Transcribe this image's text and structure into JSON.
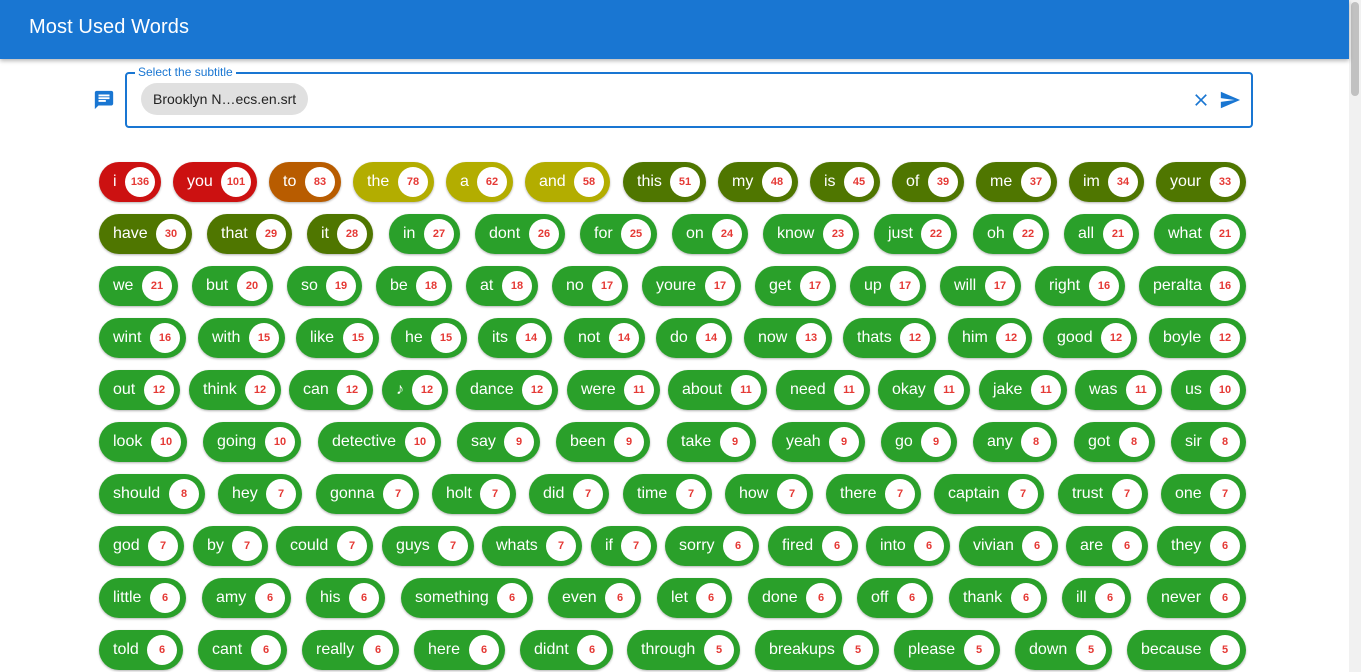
{
  "app": {
    "title": "Most Used Words"
  },
  "search": {
    "label": "Select the subtitle",
    "chip": "Brooklyn N…ecs.en.srt",
    "icons": {
      "field": "subtitles-icon",
      "clear": "close-icon",
      "send": "send-icon"
    }
  },
  "colors": {
    "appbar": "#1976d2",
    "badge_text": "#e53935",
    "levels": [
      "#cc1111",
      "#b85c00",
      "#b3ad00",
      "#4f7600",
      "#2aa02a"
    ]
  },
  "words": [
    {
      "w": "i",
      "n": 136
    },
    {
      "w": "you",
      "n": 101
    },
    {
      "w": "to",
      "n": 83
    },
    {
      "w": "the",
      "n": 78
    },
    {
      "w": "a",
      "n": 62
    },
    {
      "w": "and",
      "n": 58
    },
    {
      "w": "this",
      "n": 51
    },
    {
      "w": "my",
      "n": 48
    },
    {
      "w": "is",
      "n": 45
    },
    {
      "w": "of",
      "n": 39
    },
    {
      "w": "me",
      "n": 37
    },
    {
      "w": "im",
      "n": 34
    },
    {
      "w": "your",
      "n": 33
    },
    {
      "w": "have",
      "n": 30
    },
    {
      "w": "that",
      "n": 29
    },
    {
      "w": "it",
      "n": 28
    },
    {
      "w": "in",
      "n": 27
    },
    {
      "w": "dont",
      "n": 26
    },
    {
      "w": "for",
      "n": 25
    },
    {
      "w": "on",
      "n": 24
    },
    {
      "w": "know",
      "n": 23
    },
    {
      "w": "just",
      "n": 22
    },
    {
      "w": "oh",
      "n": 22
    },
    {
      "w": "all",
      "n": 21
    },
    {
      "w": "what",
      "n": 21
    },
    {
      "w": "we",
      "n": 21
    },
    {
      "w": "but",
      "n": 20
    },
    {
      "w": "so",
      "n": 19
    },
    {
      "w": "be",
      "n": 18
    },
    {
      "w": "at",
      "n": 18
    },
    {
      "w": "no",
      "n": 17
    },
    {
      "w": "youre",
      "n": 17
    },
    {
      "w": "get",
      "n": 17
    },
    {
      "w": "up",
      "n": 17
    },
    {
      "w": "will",
      "n": 17
    },
    {
      "w": "right",
      "n": 16
    },
    {
      "w": "peralta",
      "n": 16
    },
    {
      "w": "wint",
      "n": 16
    },
    {
      "w": "with",
      "n": 15
    },
    {
      "w": "like",
      "n": 15
    },
    {
      "w": "he",
      "n": 15
    },
    {
      "w": "its",
      "n": 14
    },
    {
      "w": "not",
      "n": 14
    },
    {
      "w": "do",
      "n": 14
    },
    {
      "w": "now",
      "n": 13
    },
    {
      "w": "thats",
      "n": 12
    },
    {
      "w": "him",
      "n": 12
    },
    {
      "w": "good",
      "n": 12
    },
    {
      "w": "boyle",
      "n": 12
    },
    {
      "w": "out",
      "n": 12
    },
    {
      "w": "think",
      "n": 12
    },
    {
      "w": "can",
      "n": 12
    },
    {
      "w": "♪",
      "n": 12
    },
    {
      "w": "dance",
      "n": 12
    },
    {
      "w": "were",
      "n": 11
    },
    {
      "w": "about",
      "n": 11
    },
    {
      "w": "need",
      "n": 11
    },
    {
      "w": "okay",
      "n": 11
    },
    {
      "w": "jake",
      "n": 11
    },
    {
      "w": "was",
      "n": 11
    },
    {
      "w": "us",
      "n": 10
    },
    {
      "w": "look",
      "n": 10
    },
    {
      "w": "going",
      "n": 10
    },
    {
      "w": "detective",
      "n": 10
    },
    {
      "w": "say",
      "n": 9
    },
    {
      "w": "been",
      "n": 9
    },
    {
      "w": "take",
      "n": 9
    },
    {
      "w": "yeah",
      "n": 9
    },
    {
      "w": "go",
      "n": 9
    },
    {
      "w": "any",
      "n": 8
    },
    {
      "w": "got",
      "n": 8
    },
    {
      "w": "sir",
      "n": 8
    },
    {
      "w": "should",
      "n": 8
    },
    {
      "w": "hey",
      "n": 7
    },
    {
      "w": "gonna",
      "n": 7
    },
    {
      "w": "holt",
      "n": 7
    },
    {
      "w": "did",
      "n": 7
    },
    {
      "w": "time",
      "n": 7
    },
    {
      "w": "how",
      "n": 7
    },
    {
      "w": "there",
      "n": 7
    },
    {
      "w": "captain",
      "n": 7
    },
    {
      "w": "trust",
      "n": 7
    },
    {
      "w": "one",
      "n": 7
    },
    {
      "w": "god",
      "n": 7
    },
    {
      "w": "by",
      "n": 7
    },
    {
      "w": "could",
      "n": 7
    },
    {
      "w": "guys",
      "n": 7
    },
    {
      "w": "whats",
      "n": 7
    },
    {
      "w": "if",
      "n": 7
    },
    {
      "w": "sorry",
      "n": 6
    },
    {
      "w": "fired",
      "n": 6
    },
    {
      "w": "into",
      "n": 6
    },
    {
      "w": "vivian",
      "n": 6
    },
    {
      "w": "are",
      "n": 6
    },
    {
      "w": "they",
      "n": 6
    },
    {
      "w": "little",
      "n": 6
    },
    {
      "w": "amy",
      "n": 6
    },
    {
      "w": "his",
      "n": 6
    },
    {
      "w": "something",
      "n": 6
    },
    {
      "w": "even",
      "n": 6
    },
    {
      "w": "let",
      "n": 6
    },
    {
      "w": "done",
      "n": 6
    },
    {
      "w": "off",
      "n": 6
    },
    {
      "w": "thank",
      "n": 6
    },
    {
      "w": "ill",
      "n": 6
    },
    {
      "w": "never",
      "n": 6
    },
    {
      "w": "told",
      "n": 6
    },
    {
      "w": "cant",
      "n": 6
    },
    {
      "w": "really",
      "n": 6
    },
    {
      "w": "here",
      "n": 6
    },
    {
      "w": "didnt",
      "n": 6
    },
    {
      "w": "through",
      "n": 5
    },
    {
      "w": "breakups",
      "n": 5
    },
    {
      "w": "please",
      "n": 5
    },
    {
      "w": "down",
      "n": 5
    },
    {
      "w": "because",
      "n": 5
    }
  ]
}
